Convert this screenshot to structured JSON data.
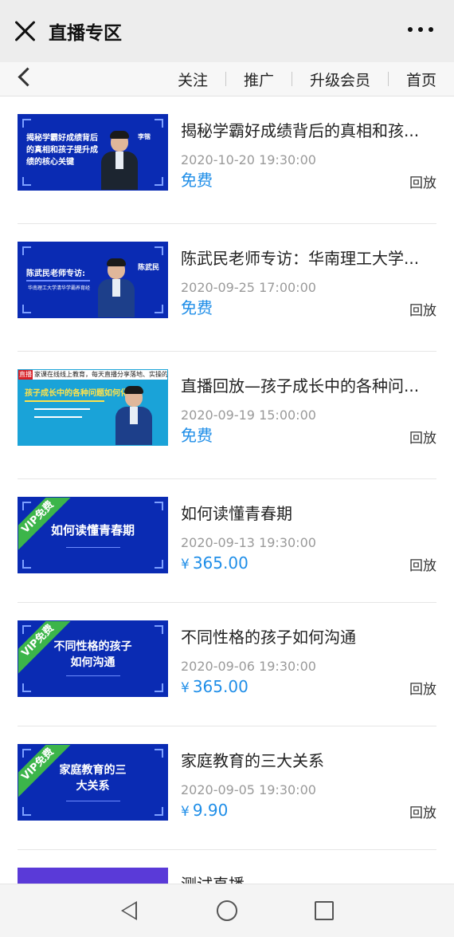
{
  "header": {
    "title": "直播专区"
  },
  "nav": {
    "items": [
      "关注",
      "推广",
      "升级会员",
      "首页"
    ]
  },
  "items": [
    {
      "title": "揭秘学霸好成绩背后的真相和孩...",
      "date": "2020-10-20 19:30:00",
      "price": "免费",
      "currency": "",
      "action": "回放",
      "thumb_lines": [
        "揭秘学霸好成绩背后",
        "的真相和孩子提升成",
        "绩的核心关键"
      ],
      "thumb_name": "李锴"
    },
    {
      "title": "陈武民老师专访：华南理工大学...",
      "date": "2020-09-25 17:00:00",
      "price": "免费",
      "currency": "",
      "action": "回放",
      "thumb_lines": [
        "陈武民老师专访:",
        "华南理工大学清华学霸养育经"
      ],
      "thumb_name": "陈武民"
    },
    {
      "title": "直播回放—孩子成长中的各种问...",
      "date": "2020-09-19 15:00:00",
      "price": "免费",
      "currency": "",
      "action": "回放",
      "thumb_lines": [
        "孩子成长中的各种问题如何化解"
      ],
      "thumb_top_tag": "直播",
      "thumb_top_text": "家课在线线上教育，每天直播分享落地、实操的育儿方法"
    },
    {
      "title": "如何读懂青春期",
      "date": "2020-09-13 19:30:00",
      "price": "365.00",
      "currency": "¥",
      "action": "回放",
      "thumb_lines": [
        "如何读懂青春期"
      ],
      "ribbon": "VIP免费"
    },
    {
      "title": "不同性格的孩子如何沟通",
      "date": "2020-09-06 19:30:00",
      "price": "365.00",
      "currency": "¥",
      "action": "回放",
      "thumb_lines": [
        "不同性格的孩子",
        "如何沟通"
      ],
      "ribbon": "VIP免费"
    },
    {
      "title": "家庭教育的三大关系",
      "date": "2020-09-05 19:30:00",
      "price": "9.90",
      "currency": "¥",
      "action": "回放",
      "thumb_lines": [
        "家庭教育的三",
        "大关系"
      ],
      "ribbon": "VIP免费"
    }
  ],
  "partial_item": {
    "title": "测试直播"
  },
  "colors": {
    "accent": "#1f8ee8",
    "thumb_blue": "#0a2bb3",
    "ribbon_green": "#3cb54a"
  }
}
